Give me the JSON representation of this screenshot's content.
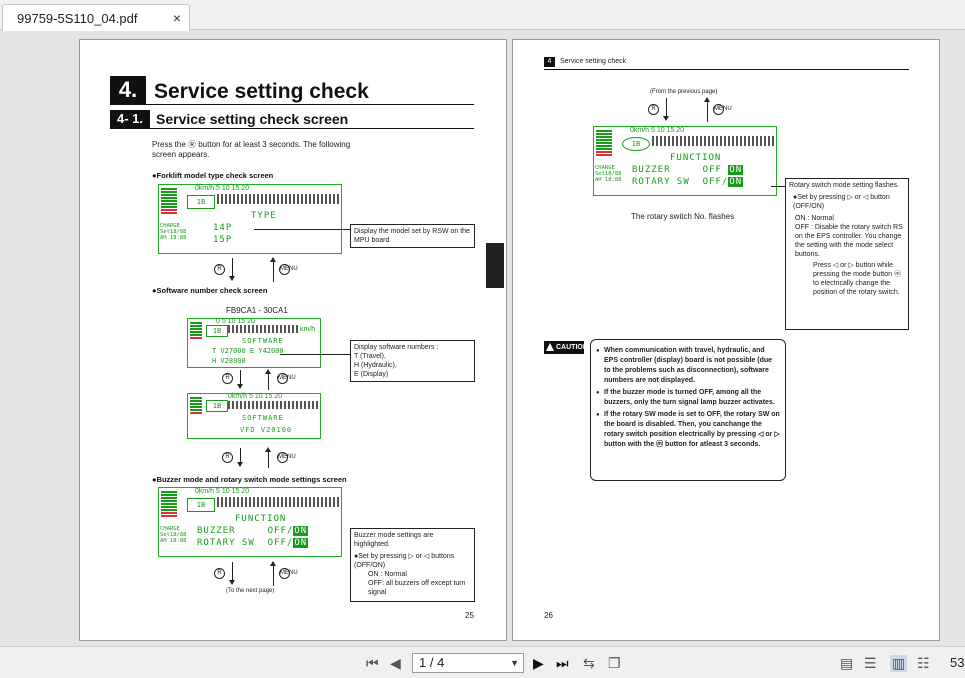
{
  "tab": {
    "title": "99759-5S110_04.pdf",
    "close": "×"
  },
  "left_page": {
    "chapter_num": "4.",
    "chapter_title": "Service setting check",
    "section_num": "4- 1.",
    "section_title": "Service setting check screen",
    "intro": "Press the Ⓡ button for at least 3 seconds. The following screen appears.",
    "h_forklift": "●Forklift model type check screen",
    "lcd1": {
      "speed": "0km/h 5     10     15     20",
      "box": "1B",
      "title": "TYPE",
      "line1": "14P",
      "line2": "15P",
      "side": "ECHARGE\nSet18/88\nAH 18:88"
    },
    "note1": "Display the model set by RSW on the MPU board",
    "h_software": "●Software number check screen",
    "sw_label": "FB9CA1 - 30CA1",
    "lcd2": {
      "speed": "0   5    10   15   20",
      "unit": "km/h",
      "box": "1B",
      "title": "SOFTWARE",
      "line1": "T   V27000    E   Y42000",
      "line2": "H   V28000"
    },
    "note2": "Display software numbers :\nT (Travel),\nH (Hydraulic),\nE (Display)",
    "lcd3": {
      "speed": "0km/h 5    10   15   20",
      "box": "1B",
      "title": "SOFTWARE",
      "line1": "VFD  V20100"
    },
    "h_buzzer": "●Buzzer mode and rotary switch mode settings screen",
    "lcd4": {
      "speed": "0km/h 5     10     15     20",
      "box": "1B",
      "title": "FUNCTION",
      "line1a": "BUZZER",
      "line1b": "OFF/",
      "line1c": "ON",
      "line2a": "ROTARY  SW",
      "line2b": "OFF/",
      "line2c": "ON"
    },
    "note4": {
      "title": "Buzzer mode settings are highlighted.",
      "b1": "●Set by pressing ▷ or ◁ buttons (OFF/ON)",
      "on": "ON : Normal",
      "off": "OFF: all buzzers off except turn signal"
    },
    "next_page": "(To the next page)",
    "page_number": "25",
    "circle_r": "R",
    "circle_m": "MENU"
  },
  "right_page": {
    "header_num": "4",
    "header": "Service setting check",
    "from_prev": "(From the previous page)",
    "lcd": {
      "speed": "0km/h 5     10     15     20",
      "box": "1B",
      "title": "FUNCTION",
      "line1a": "BUZZER",
      "line1b": "OFF",
      "line1c": "ON",
      "line2a": "ROTARY  SW",
      "line2b": "OFF/",
      "line2c": "ON"
    },
    "flash_caption": "The rotary switch No. flashes",
    "note": {
      "title": "Rotary switch mode setting flashes.",
      "b1": "●Set by pressing ▷ or ◁ button (OFF/ON)",
      "on": "ON : Normal",
      "off": "OFF : Disable the rotary switch RS on the EPS controller. You change the setting with the mode select buttons.",
      "press": "Press ◁ or ▷ button while pressing the mode button ⓜ to electrically change the position of the rotary switch."
    },
    "caution_label": "CAUTION",
    "caution": [
      "When communication with travel, hydraulic, and EPS controller (display) board is not possible (due to the problems such as disconnection), software numbers are not displayed.",
      "If the buzzer mode is turned OFF, among all the buzzers, only the turn signal lamp buzzer activates.",
      "If the rotary SW mode is set to OFF, the rotary SW on the board is disabled. Then, you canchange the rotary switch  position electrically by pressing ◁ or ▷ button with the ⓜ button for atleast 3 seconds."
    ],
    "page_number": "26"
  },
  "toolbar": {
    "page_value": "1 / 4",
    "zoom": "53"
  }
}
